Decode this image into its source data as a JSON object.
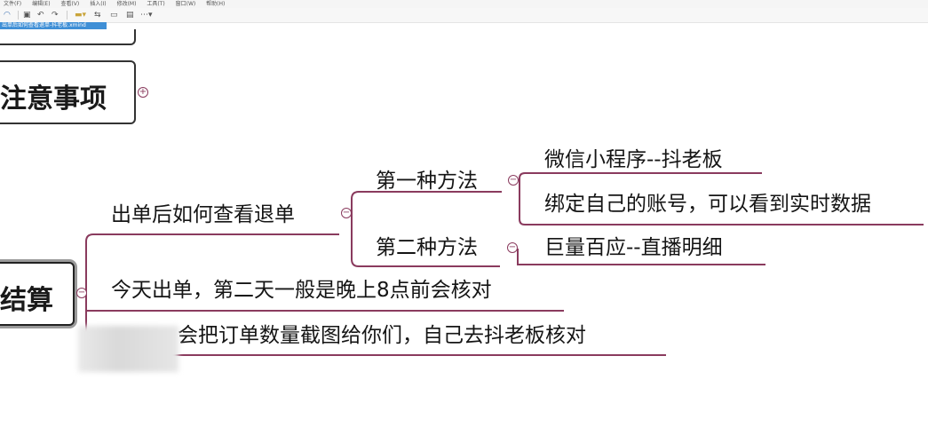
{
  "menu": [
    "文件(F)",
    "编辑(E)",
    "查看(V)",
    "插入(I)",
    "修改(M)",
    "工具(T)",
    "窗口(W)",
    "帮助(H)"
  ],
  "toolbar": {
    "save_icon": "save-icon",
    "undo_icon": "undo-icon",
    "redo_icon": "redo-icon",
    "more_icon": "more-icon"
  },
  "doc_tab": "出单后如何查看退单-抖老板.xmind",
  "nodes": {
    "notes": "注意事项",
    "settlement": "结算",
    "check_refund": "出单后如何查看退单",
    "method1": "第一种方法",
    "method1_a": "微信小程序--抖老板",
    "method1_b": "绑定自己的账号，可以看到实时数据",
    "method2": "第二种方法",
    "method2_a": "巨量百应--直播明细",
    "today": "今天出单，第二天一般是晚上8点前会核对",
    "screenshot": "会把订单数量截图给你们，自己去抖老板核对"
  },
  "colors": {
    "branch": "#8a3b5e",
    "tab": "#3f8fd6",
    "border": "#333333"
  }
}
